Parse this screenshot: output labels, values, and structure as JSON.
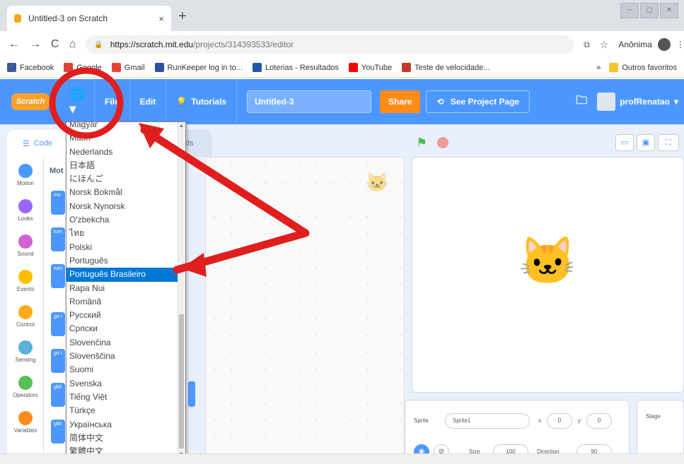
{
  "browser": {
    "tab_title": "Untitled-3 on Scratch",
    "tab_close": "×",
    "new_tab": "+",
    "url_main": "https://scratch.mit.edu",
    "url_rest": "/projects/314393533/editor",
    "profile_name": "Anônima",
    "window_controls": [
      "─",
      "▢",
      "✕"
    ]
  },
  "bookmarks": {
    "items": [
      {
        "label": "Facebook",
        "color": "#3b5998"
      },
      {
        "label": "Google",
        "color": "#db4437"
      },
      {
        "label": "Gmail",
        "color": "#ea4335"
      },
      {
        "label": "RunKeeper log in to...",
        "color": "#2a4fa3"
      },
      {
        "label": "Loterias - Resultados",
        "color": "#1e5aa8"
      },
      {
        "label": "YouTube",
        "color": "#ff0000"
      },
      {
        "label": "Teste de velocidade...",
        "color": "#c0392b"
      }
    ],
    "more": "»",
    "other": "Outros favoritos"
  },
  "menubar": {
    "logo": "Scratch",
    "file": "File",
    "edit": "Edit",
    "tutorials": "Tutorials",
    "project_title": "Untitled-3",
    "share": "Share",
    "see_project": "See Project Page",
    "user": "profRenatao"
  },
  "editor": {
    "code_tab": "Code",
    "sounds_tab": "ds",
    "palette_heading": "Mot",
    "categories": [
      {
        "label": "Motion",
        "color": "#4c97ff"
      },
      {
        "label": "Looks",
        "color": "#9966ff"
      },
      {
        "label": "Sound",
        "color": "#cf63cf"
      },
      {
        "label": "Events",
        "color": "#ffbf00"
      },
      {
        "label": "Control",
        "color": "#ffab19"
      },
      {
        "label": "Sensing",
        "color": "#5cb1d6"
      },
      {
        "label": "Operators",
        "color": "#59c059"
      },
      {
        "label": "Variables",
        "color": "#ff8c1a"
      }
    ],
    "blocks": [
      "mo",
      "turn",
      "turn",
      "go t",
      "go t",
      "glid",
      "glid"
    ]
  },
  "sprite_info": {
    "sprite_label": "Sprite",
    "sprite_name": "Sprite1",
    "x_label": "x",
    "x_value": "0",
    "y_label": "y",
    "y_value": "0",
    "size_label": "Size",
    "size_value": "100",
    "direction_label": "Direction",
    "direction_value": "90",
    "stage_label": "Stage"
  },
  "language_menu": {
    "items": [
      "Magyar",
      "Māori",
      "Nederlands",
      "日本語",
      "にほんご",
      "Norsk Bokmål",
      "Norsk Nynorsk",
      "O'zbekcha",
      "ไทย",
      "Polski",
      "Português",
      "Português Brasileiro",
      "Rapa Nui",
      "Română",
      "Русский",
      "Српски",
      "Slovenčina",
      "Slovenščina",
      "Suomi",
      "Svenska",
      "Tiếng Việt",
      "Türkçe",
      "Українська",
      "简体中文",
      "繁體中文"
    ],
    "selected": "Português Brasileiro"
  }
}
